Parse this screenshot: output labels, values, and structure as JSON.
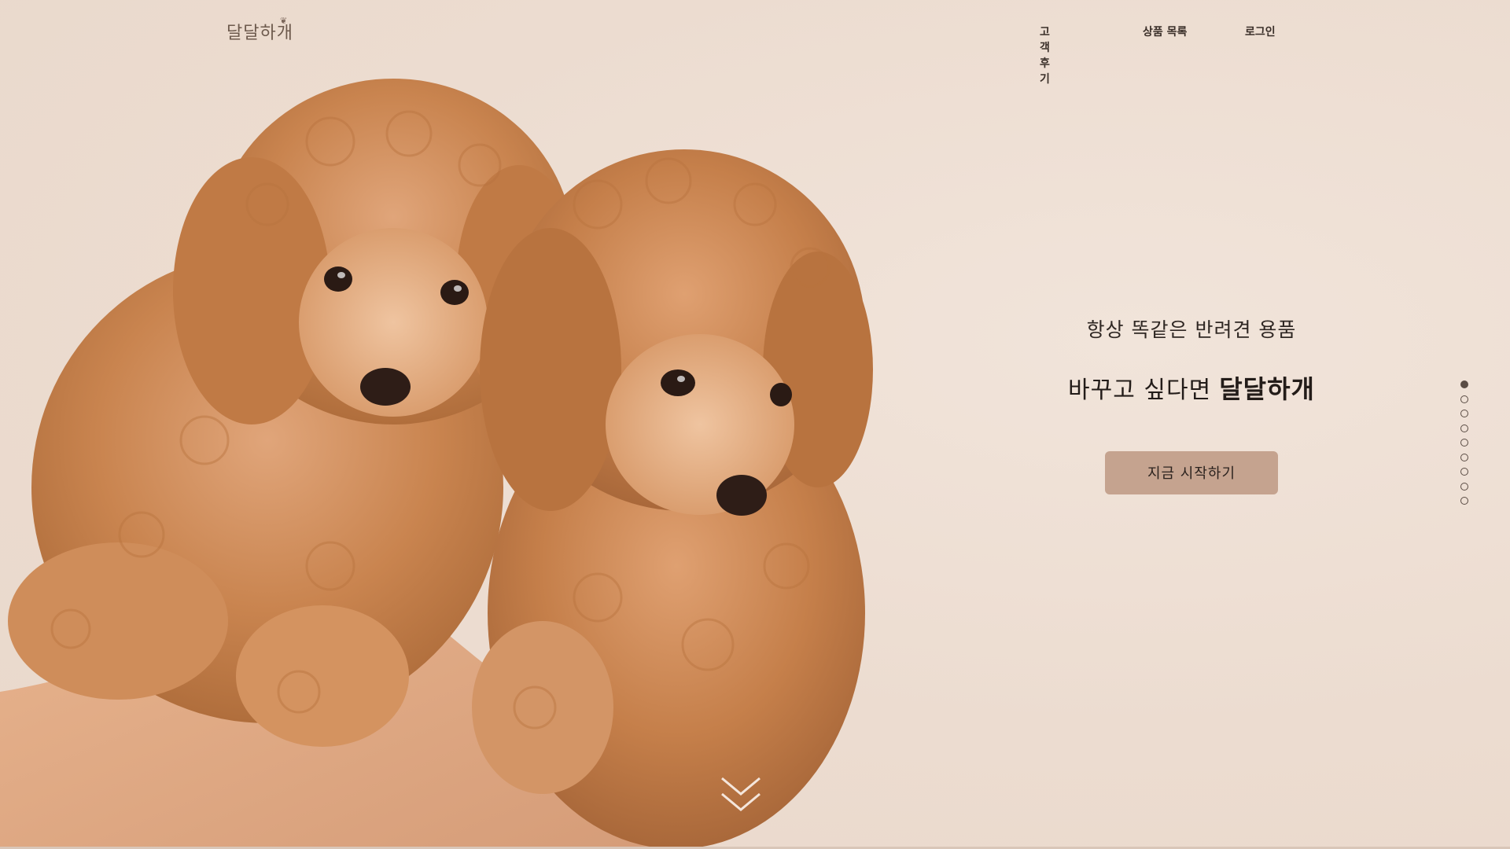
{
  "header": {
    "logo_text": "달달하개",
    "nav": {
      "reviews_label": "고객 후기",
      "products_label": "상품 목록",
      "login_label": "로그인"
    }
  },
  "hero": {
    "subtitle": "항상 똑같은 반려견 용품",
    "headline_prefix": "바꾸고 싶다면",
    "headline_brand": "달달하개",
    "cta_label": "지금 시작하기",
    "image_alt_icon": "puppies-photo-icon"
  },
  "section_nav": {
    "count": 9,
    "active_index": 0
  },
  "colors": {
    "background": "#ecdcd0",
    "cta_background": "#c5a38f",
    "text_dark": "#231c19",
    "dot": "#5a4c44"
  },
  "icons": {
    "scroll": "chevron-double-down-icon",
    "paw": "paw-icon"
  }
}
